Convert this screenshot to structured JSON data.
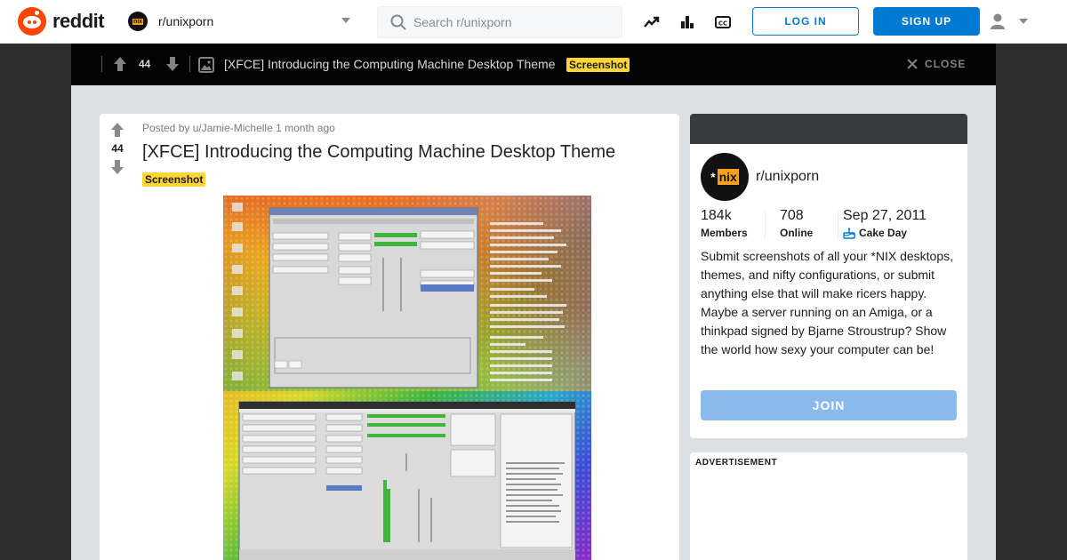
{
  "header": {
    "logo_text": "reddit",
    "subreddit": "r/unixporn",
    "subreddit_icon_text": "nix",
    "search_placeholder": "Search r/unixporn",
    "login_label": "LOG IN",
    "signup_label": "SIGN UP",
    "icons": [
      "trending-icon",
      "stats-icon",
      "closed-caption-icon",
      "user-icon",
      "chevron-down-icon"
    ]
  },
  "postbar": {
    "score": "44",
    "title": "[XFCE] Introducing the Computing Machine Desktop Theme",
    "flair": "Screenshot",
    "close_label": "CLOSE"
  },
  "post": {
    "score": "44",
    "posted_by_prefix": "Posted by",
    "author": "u/Jamie-Michelle",
    "age": "1 month ago",
    "title": "[XFCE] Introducing the Computing Machine Desktop Theme",
    "flair": "Screenshot"
  },
  "sidebar": {
    "community_icon_star": "*",
    "community_icon_text": "nix",
    "community_name": "r/unixporn",
    "members_value": "184k",
    "members_label": "Members",
    "online_value": "708",
    "online_label": "Online",
    "created_value": "Sep 27, 2011",
    "created_label": "Cake Day",
    "about": "Submit screenshots of all your *NIX desktops, themes, and nifty configurations, or submit anything else that will make ricers happy. Maybe a server running on an Amiga, or a thinkpad signed by Bjarne Stroustrup? Show the world how sexy your computer can be!",
    "join_label": "JOIN"
  },
  "ad": {
    "label": "ADVERTISEMENT"
  },
  "colors": {
    "brand": "#ff4500",
    "primary_blue": "#0079d3",
    "flair_yellow": "#ffd635",
    "join_disabled": "#8ab9ec",
    "overlay_dark": "#2e2e2e",
    "post_bar": "#030303"
  }
}
